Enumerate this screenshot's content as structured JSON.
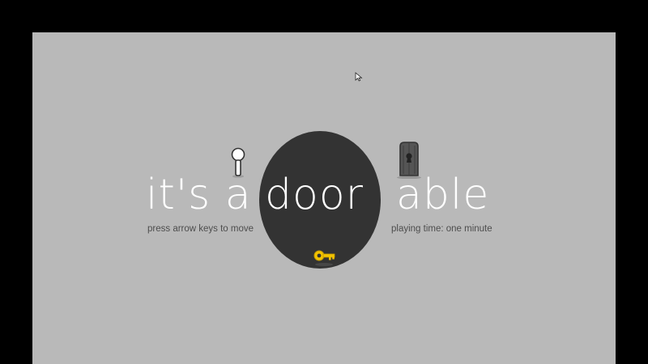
{
  "game": {
    "title_left": "it's a",
    "title_middle": "door",
    "title_right": "able",
    "instructions": "press arrow keys to move",
    "playing_time": "playing time: one minute"
  },
  "colors": {
    "background": "#b9b9b9",
    "circle": "#333333",
    "title_text": "#ffffff",
    "sub_text": "#4d4d4d",
    "key": "#f2c200"
  },
  "icons": {
    "player": "stick-figure-icon",
    "door": "locked-door-icon",
    "key": "key-icon",
    "cursor": "mouse-pointer-icon"
  }
}
